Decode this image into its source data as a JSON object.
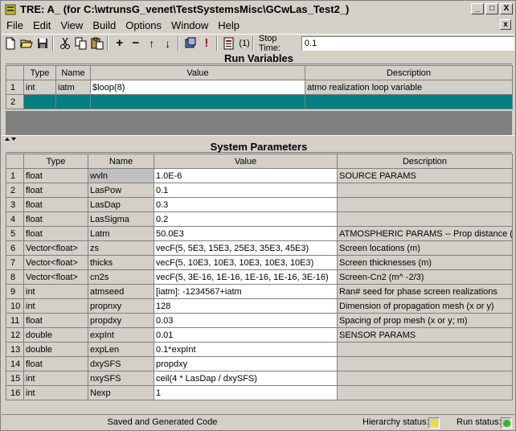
{
  "window": {
    "title": "TRE:  A_  (for C:\\wtrunsG_venet\\TestSystemsMisc\\GCwLas_Test2_)",
    "minimize_glyph": "_",
    "maximize_glyph": "□",
    "close_glyph": "X"
  },
  "menu": {
    "items": [
      "File",
      "Edit",
      "View",
      "Build",
      "Options",
      "Window",
      "Help"
    ],
    "close_glyph": "x"
  },
  "toolbar": {
    "icons": [
      "new-file-icon",
      "open-folder-icon",
      "save-icon",
      "cut-icon",
      "copy-icon",
      "paste-icon",
      "add-row-icon",
      "remove-row-icon",
      "move-up-icon",
      "move-down-icon",
      "build-icon",
      "run-icon",
      "print-icon"
    ],
    "glyphs": {
      "add": "+",
      "remove": "−",
      "up": "↑",
      "down": "↓",
      "run": "!"
    },
    "counter_label": "(1)",
    "stop_time_label": "Stop Time:",
    "stop_time_value": "0.1"
  },
  "run_variables": {
    "title": "Run Variables",
    "columns": [
      "",
      "Type",
      "Name",
      "Value",
      "Description"
    ],
    "rows": [
      {
        "num": "1",
        "type": "int",
        "name": "iatm",
        "value": "$loop(8)",
        "description": "atmo realization loop variable"
      },
      {
        "num": "2",
        "type": "",
        "name": "",
        "value": "",
        "description": ""
      }
    ]
  },
  "system_parameters": {
    "title": "System Parameters",
    "columns": [
      "",
      "Type",
      "Name",
      "Value",
      "Description"
    ],
    "rows": [
      {
        "num": "1",
        "type": "float",
        "name": "wvln",
        "value": "1.0E-6",
        "description": "SOURCE PARAMS"
      },
      {
        "num": "2",
        "type": "float",
        "name": "LasPow",
        "value": "0.1",
        "description": ""
      },
      {
        "num": "3",
        "type": "float",
        "name": "LasDap",
        "value": "0.3",
        "description": ""
      },
      {
        "num": "4",
        "type": "float",
        "name": "LasSigma",
        "value": "0.2",
        "description": ""
      },
      {
        "num": "5",
        "type": "float",
        "name": "Latm",
        "value": "50.0E3",
        "description": "ATMOSPHERIC PARAMS -- Prop distance (m)"
      },
      {
        "num": "6",
        "type": "Vector<float>",
        "name": "zs",
        "value": "vecF(5, 5E3, 15E3, 25E3, 35E3, 45E3)",
        "description": "Screen locations (m)"
      },
      {
        "num": "7",
        "type": "Vector<float>",
        "name": "thicks",
        "value": "vecF(5, 10E3, 10E3, 10E3, 10E3, 10E3)",
        "description": "Screen thicknesses (m)"
      },
      {
        "num": "8",
        "type": "Vector<float>",
        "name": "cn2s",
        "value": "vecF(5, 3E-16, 1E-16, 1E-16, 1E-16, 3E-16)",
        "description": "Screen-Cn2 (m^ -2/3)"
      },
      {
        "num": "9",
        "type": "int",
        "name": "atmseed",
        "value": "[iatm]: -1234567+iatm",
        "description": "Ran# seed for phase screen realizations"
      },
      {
        "num": "10",
        "type": "int",
        "name": "propnxy",
        "value": "128",
        "description": "Dimension of propagation mesh (x or y)"
      },
      {
        "num": "11",
        "type": "float",
        "name": "propdxy",
        "value": "0.03",
        "description": "Spacing of prop mesh (x or y; m)"
      },
      {
        "num": "12",
        "type": "double",
        "name": "expInt",
        "value": "0.01",
        "description": "SENSOR PARAMS"
      },
      {
        "num": "13",
        "type": "double",
        "name": "expLen",
        "value": "0.1*expInt",
        "description": ""
      },
      {
        "num": "14",
        "type": "float",
        "name": "dxySFS",
        "value": "propdxy",
        "description": ""
      },
      {
        "num": "15",
        "type": "int",
        "name": "nxySFS",
        "value": "ceil(4 * LasDap / dxySFS)",
        "description": ""
      },
      {
        "num": "16",
        "type": "int",
        "name": "Nexp",
        "value": "1",
        "description": ""
      }
    ]
  },
  "status": {
    "message": "Saved and Generated Code",
    "hierarchy_label": "Hierarchy status:",
    "run_label": "Run status:",
    "hierarchy_color": "#f0e020",
    "run_color": "#20c020"
  },
  "colors": {
    "highlight_row": "#008080",
    "window_bg": "#d4d0c8"
  }
}
